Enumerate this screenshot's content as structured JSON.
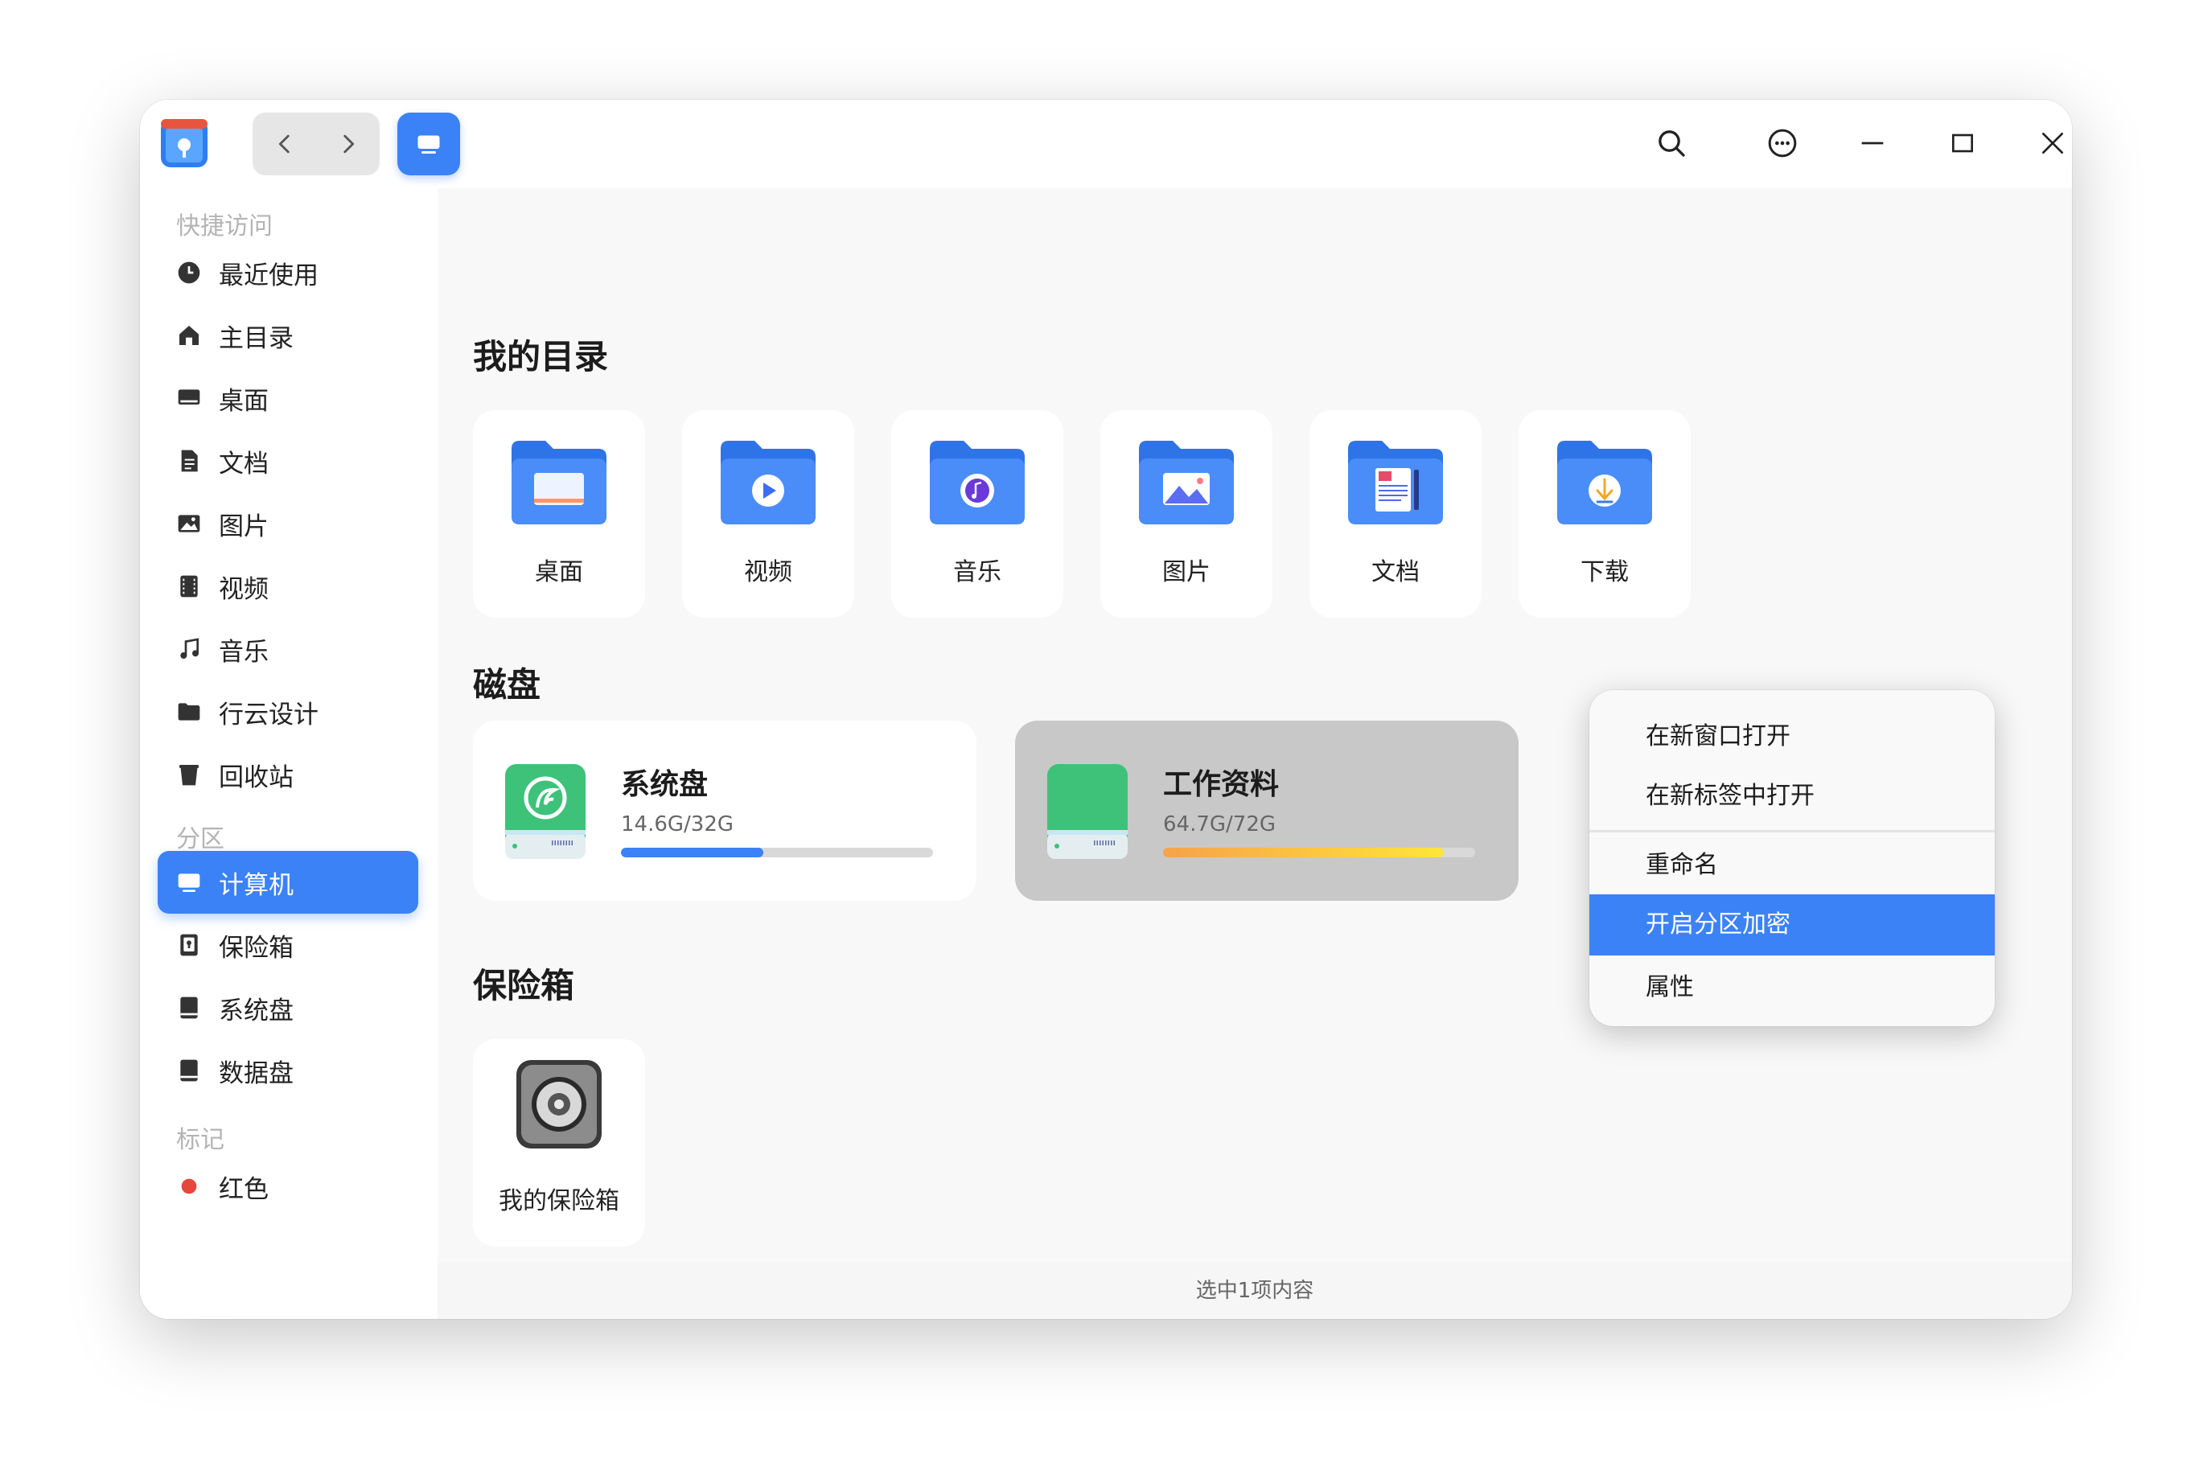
{
  "titlebar": {
    "app_icon": "file-manager-icon",
    "back_icon": "chevron-left-icon",
    "forward_icon": "chevron-right-icon",
    "view_icon": "computer-icon",
    "search_icon": "search-icon",
    "menu_icon": "more-icon",
    "minimize_icon": "minimize-icon",
    "maximize_icon": "maximize-icon",
    "close_icon": "close-icon"
  },
  "sidebar": {
    "quick_access_label": "快捷访问",
    "quick_items": [
      {
        "label": "最近使用",
        "icon": "clock-icon"
      },
      {
        "label": "主目录",
        "icon": "home-icon"
      },
      {
        "label": "桌面",
        "icon": "desktop-icon"
      },
      {
        "label": "文档",
        "icon": "document-icon"
      },
      {
        "label": "图片",
        "icon": "image-icon"
      },
      {
        "label": "视频",
        "icon": "video-icon"
      },
      {
        "label": "音乐",
        "icon": "music-icon"
      },
      {
        "label": "行云设计",
        "icon": "folder-icon"
      },
      {
        "label": "回收站",
        "icon": "trash-icon"
      }
    ],
    "partition_label": "分区",
    "partition_items": [
      {
        "label": "计算机",
        "icon": "computer-icon",
        "active": true
      },
      {
        "label": "保险箱",
        "icon": "vault-icon"
      },
      {
        "label": "系统盘",
        "icon": "drive-icon"
      },
      {
        "label": "数据盘",
        "icon": "drive-icon"
      }
    ],
    "tags_label": "标记",
    "tag_items": [
      {
        "label": "红色",
        "color": "#e5483b"
      }
    ]
  },
  "main": {
    "my_dirs_title": "我的目录",
    "folders": [
      {
        "label": "桌面",
        "icon": "desktop-folder-icon"
      },
      {
        "label": "视频",
        "icon": "video-folder-icon"
      },
      {
        "label": "音乐",
        "icon": "music-folder-icon"
      },
      {
        "label": "图片",
        "icon": "pictures-folder-icon"
      },
      {
        "label": "文档",
        "icon": "documents-folder-icon"
      },
      {
        "label": "下载",
        "icon": "downloads-folder-icon"
      }
    ],
    "disks_title": "磁盘",
    "disks": [
      {
        "name": "系统盘",
        "size": "14.6G/32G",
        "usage": 0.456,
        "bar_color": "#3b82f6",
        "selected": false
      },
      {
        "name": "工作资料",
        "size": "64.7G/72G",
        "usage": 0.9,
        "bar_color": "#f5c518",
        "selected": true
      }
    ],
    "vault_title": "保险箱",
    "vault_label": "我的保险箱"
  },
  "statusbar": {
    "text": "选中1项内容"
  },
  "context_menu": {
    "items": [
      "在新窗口打开",
      "在新标签中打开",
      "重命名",
      "开启分区加密",
      "属性"
    ],
    "highlighted": "开启分区加密"
  },
  "colors": {
    "accent": "#3b82f6",
    "folder_blue": "#4a8df8",
    "drive_green": "#3ec27a"
  }
}
